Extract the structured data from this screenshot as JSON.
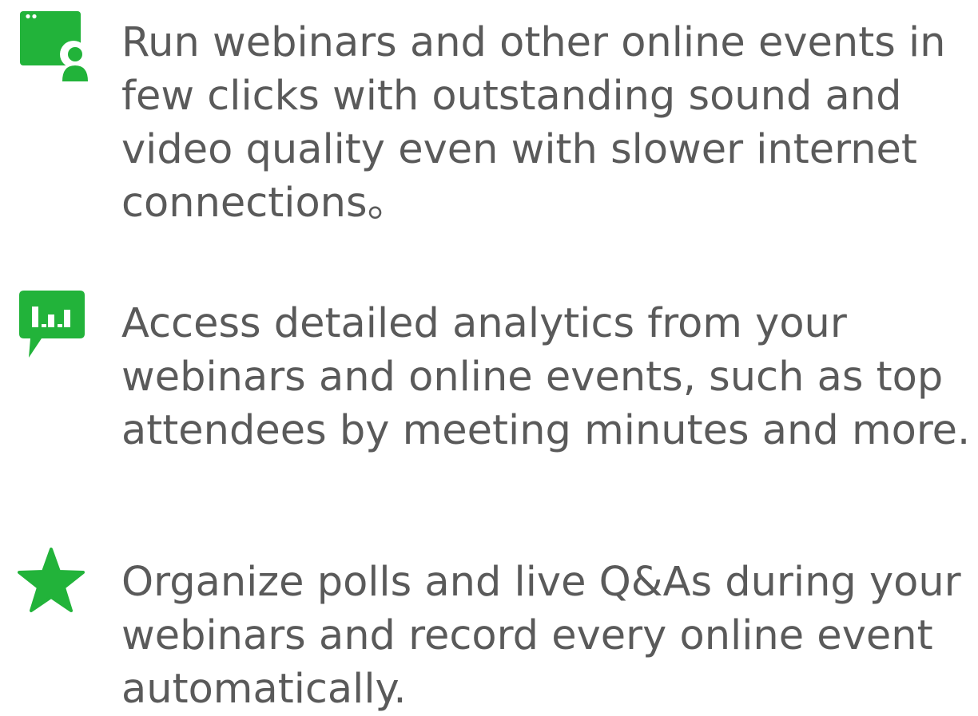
{
  "theme": {
    "accent": "#22b33a",
    "text": "#5a5a5a"
  },
  "features": [
    {
      "icon": "webinar-presenter-icon",
      "text": "Run webinars and other online events in\nfew clicks with outstanding sound and\nvideo quality even with slower internet\nconnections。"
    },
    {
      "icon": "analytics-chat-icon",
      "text": "Access detailed analytics from your\nwebinars and online events, such as top\nattendees by meeting minutes and more."
    },
    {
      "icon": "star-icon",
      "text": "Organize polls and live Q&As during your\nwebinars and record every online event\nautomatically."
    }
  ]
}
